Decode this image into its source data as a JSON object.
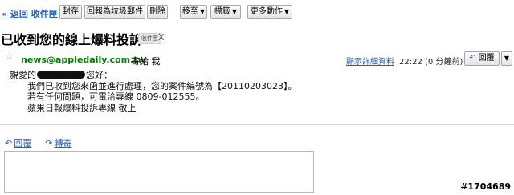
{
  "toolbar": {
    "back_label": "« 返回 收件匣",
    "archive_label": "封存",
    "spam_label": "回報為垃圾郵件",
    "delete_label": "刪除",
    "move_label": "移至",
    "labels_label": "標籤",
    "more_actions_label": "更多動作"
  },
  "subject": {
    "title": "已收到您的線上爆料投訴",
    "label_chip": "收件匣",
    "label_remove": "X"
  },
  "message": {
    "sender_email": "news@appledaily.com.tw",
    "to_text": "寄給 我",
    "details_link": "顯示詳細資料",
    "datetime": "22:22 (0 分鐘前)",
    "reply_label": "回覆",
    "body": {
      "greeting_prefix": "親愛的",
      "greeting_suffix": "您好：",
      "line1": "我們已收到您來函並進行處理，您的案件編號為【20110203023】。",
      "line2": "若有任何問題，可電洽專線 0809-012555。",
      "line3": "蘋果日報爆料投訴專線 敬上"
    }
  },
  "actions": {
    "reply_label": "回覆",
    "forward_label": "轉寄"
  },
  "watermark": "#1704689",
  "icons": {
    "star": "star-icon",
    "reply": "reply-arrow-icon",
    "forward": "forward-arrow-icon",
    "dropdown": "chevron-down-icon"
  },
  "colors": {
    "link": "#2a5db0",
    "sender": "#008000",
    "divider": "#c3d9ff"
  }
}
